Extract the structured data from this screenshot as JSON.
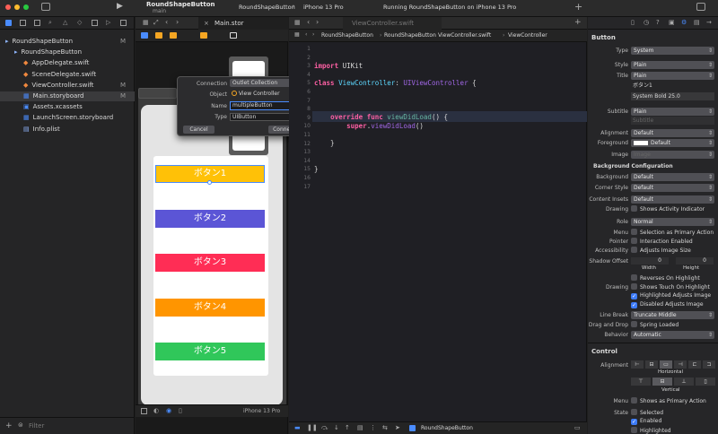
{
  "toolbar": {
    "project_name": "RoundShapeButton",
    "branch": "main",
    "scheme": "RoundShapeButton",
    "device": "iPhone 13 Pro",
    "status": "Running RoundShapeButton on iPhone 13 Pro",
    "play_icon": "▶",
    "add_icon": "+"
  },
  "navigator": {
    "items": [
      {
        "label": "RoundShapeButton",
        "badge": "M",
        "icon": "▸",
        "depth": 0
      },
      {
        "label": "RoundShapeButton",
        "badge": "",
        "icon": "▸",
        "depth": 1
      },
      {
        "label": "AppDelegate.swift",
        "badge": "",
        "icon": "◆",
        "depth": 2
      },
      {
        "label": "SceneDelegate.swift",
        "badge": "",
        "icon": "◆",
        "depth": 2
      },
      {
        "label": "ViewController.swift",
        "badge": "M",
        "icon": "◆",
        "depth": 2
      },
      {
        "label": "Main.storyboard",
        "badge": "M",
        "icon": "▦",
        "depth": 2
      },
      {
        "label": "Assets.xcassets",
        "badge": "",
        "icon": "▣",
        "depth": 2
      },
      {
        "label": "LaunchScreen.storyboard",
        "badge": "",
        "icon": "▦",
        "depth": 2
      },
      {
        "label": "Info.plist",
        "badge": "",
        "icon": "▤",
        "depth": 2
      }
    ],
    "filter_placeholder": "Filter"
  },
  "canvas": {
    "tab_label": "Main.stor",
    "device_label": "iPhone 13 Pro",
    "buttons": [
      {
        "label": "ボタン1",
        "color": "#ffc107"
      },
      {
        "label": "ボタン2",
        "color": "#5b55d6"
      },
      {
        "label": "ボタン3",
        "color": "#ff2d55"
      },
      {
        "label": "ボタン4",
        "color": "#ff9500"
      },
      {
        "label": "ボタン5",
        "color": "#30c75a"
      }
    ]
  },
  "connection_dialog": {
    "connection_label": "Connection",
    "connection_value": "Outlet Collection",
    "object_label": "Object",
    "object_value": "View Controller",
    "name_label": "Name",
    "name_value": "multipleButton",
    "type_label": "Type",
    "type_value": "UIButton",
    "cancel_label": "Cancel",
    "connect_label": "Connect"
  },
  "editor": {
    "tab_label": "ViewController.swift",
    "breadcrumb": [
      "RoundShapeButton",
      "RoundShapeButton",
      "ViewController.swift",
      "ViewController"
    ],
    "line_numbers": [
      "1",
      "2",
      "3",
      "4",
      "5",
      "6",
      "7",
      "8",
      "9",
      "10",
      "11",
      "12",
      "13",
      "14",
      "15",
      "16",
      "17"
    ]
  },
  "inspector": {
    "section_title": "Button",
    "type_label": "Type",
    "type_value": "System",
    "style_label": "Style",
    "style_value": "Plain",
    "title_label": "Title",
    "title_value": "Plain",
    "title_text": "ボタン1",
    "font_value": "System Bold 25.0",
    "subtitle_label": "Subtitle",
    "subtitle_value": "Plain",
    "subtitle_placeholder": "Subtitle",
    "alignment_label": "Alignment",
    "alignment_value": "Default",
    "foreground_label": "Foreground",
    "foreground_value": "Default",
    "image_label": "Image",
    "image_placeholder": "Image",
    "bg_config_title": "Background Configuration",
    "background_label": "Background",
    "background_value": "Default",
    "corner_label": "Corner Style",
    "corner_value": "Default",
    "insets_label": "Content Insets",
    "insets_value": "Default",
    "drawing_label": "Drawing",
    "drawing_option": "Shows Activity Indicator",
    "role_label": "Role",
    "role_value": "Normal",
    "menu_label": "Menu",
    "menu_option": "Selection as Primary Action",
    "pointer_label": "Pointer",
    "pointer_option": "Interaction Enabled",
    "accessibility_label": "Accessibility",
    "accessibility_option": "Adjusts Image Size",
    "shadow_label": "Shadow Offset",
    "shadow_w": "0",
    "shadow_h": "0",
    "width_label": "Width",
    "height_label": "Height",
    "reverses_option": "Reverses On Highlight",
    "drawing2_label": "Drawing",
    "touch_option": "Shows Touch On Highlight",
    "highlighted_option": "Highlighted Adjusts Image",
    "disabled_option": "Disabled Adjusts Image",
    "linebreak_label": "Line Break",
    "linebreak_value": "Truncate Middle",
    "dragdrop_label": "Drag and Drop",
    "dragdrop_option": "Spring Loaded",
    "behavior_label": "Behavior",
    "behavior_value": "Automatic",
    "control_title": "Control",
    "ctrl_alignment_label": "Alignment",
    "horizontal_label": "Horizontal",
    "vertical_label": "Vertical",
    "ctrl_menu_label": "Menu",
    "ctrl_menu_option": "Shows as Primary Action",
    "state_label": "State",
    "state_selected": "Selected",
    "state_enabled": "Enabled",
    "state_highlighted": "Highlighted"
  },
  "bottom": {
    "target_label": "RoundShapeButton"
  }
}
